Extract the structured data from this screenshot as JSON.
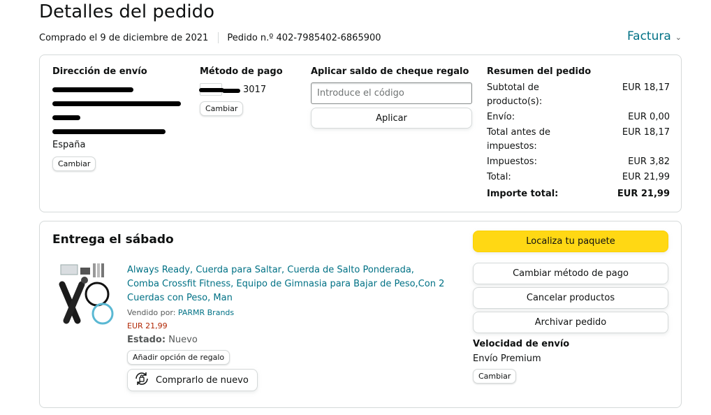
{
  "header": {
    "title": "Detalles del pedido",
    "purchased": "Comprado el 9 de diciembre de 2021",
    "order_number": "Pedido n.º 402-7985402-6865900",
    "invoice_label": "Factura"
  },
  "shipping": {
    "title": "Dirección de envío",
    "country": "España",
    "change_label": "Cambiar"
  },
  "payment": {
    "title": "Método de pago",
    "card_suffix": "3017",
    "change_label": "Cambiar"
  },
  "gift_card": {
    "title": "Aplicar saldo de cheque regalo",
    "placeholder": "Introduce el código",
    "apply_label": "Aplicar"
  },
  "summary": {
    "title": "Resumen del pedido",
    "rows": [
      {
        "label": "Subtotal de producto(s):",
        "value": "EUR 18,17"
      },
      {
        "label": "Envío:",
        "value": "EUR 0,00"
      },
      {
        "label": "Total antes de impuestos:",
        "value": "EUR 18,17"
      },
      {
        "label": "Impuestos:",
        "value": "EUR 3,82"
      },
      {
        "label": "Total:",
        "value": "EUR 21,99"
      }
    ],
    "grand_total_label": "Importe total:",
    "grand_total_value": "EUR 21,99"
  },
  "delivery": {
    "title": "Entrega el sábado",
    "product": {
      "title": "Always Ready, Cuerda para Saltar, Cuerda de Salto Ponderada, Comba Crossfit Fitness, Equipo de Gimnasia para Bajar de Peso,Con 2 Cuerdas con Peso, Man",
      "sold_by_label": "Vendido por:",
      "seller": "PARMR Brands",
      "price": "EUR 21,99",
      "status_label": "Estado:",
      "status_value": "Nuevo",
      "gift_option_label": "Añadir opción de regalo",
      "buy_again_label": "Comprarlo de nuevo"
    },
    "actions": {
      "track": "Localiza tu paquete",
      "change_payment": "Cambiar método de pago",
      "cancel": "Cancelar productos",
      "archive": "Archivar pedido"
    },
    "speed": {
      "title": "Velocidad de envío",
      "value": "Envío Premium",
      "change_label": "Cambiar"
    }
  },
  "colors": {
    "link": "#007185",
    "price": "#b12704",
    "primary_button": "#ffd814",
    "border": "#d5d9d9"
  }
}
